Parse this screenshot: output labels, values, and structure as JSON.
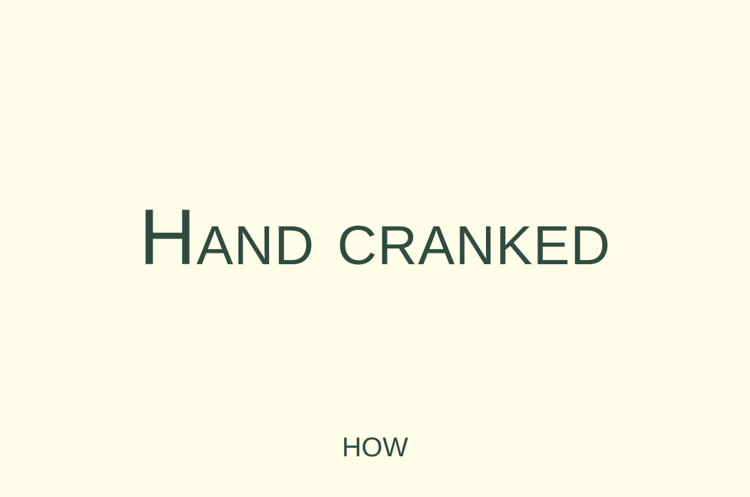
{
  "hero": {
    "title": "Hand cranked"
  },
  "footer": {
    "how_label": "HOW"
  },
  "colors": {
    "background": "#fefee8",
    "text": "#304c40"
  }
}
